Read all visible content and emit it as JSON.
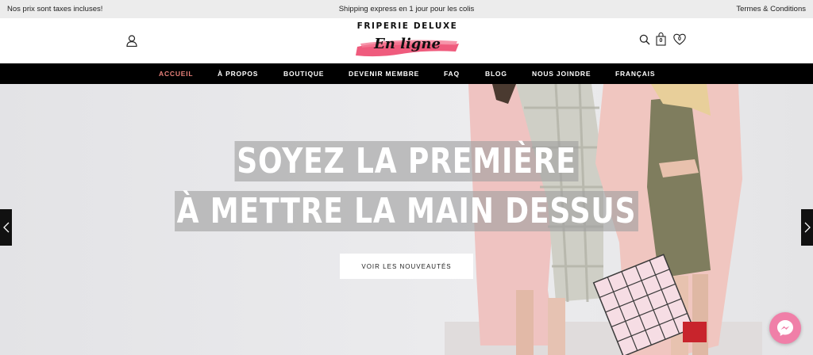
{
  "topbar": {
    "left_text": "Nos prix sont taxes incluses!",
    "center_text": "Shipping express en 1 jour pour les colis",
    "right_link": "Termes & Conditions"
  },
  "header": {
    "logo_brand": "FRIPERIE DELUXE",
    "logo_script": "En ligne",
    "cart_count": "0",
    "wishlist_count": "0",
    "icons": [
      "user-icon",
      "search-icon",
      "shopping-bag-icon",
      "heart-icon"
    ]
  },
  "nav": {
    "items": [
      {
        "label": "ACCUEIL",
        "active": true
      },
      {
        "label": "À PROPOS"
      },
      {
        "label": "BOUTIQUE"
      },
      {
        "label": "DEVENIR MEMBRE"
      },
      {
        "label": "FAQ"
      },
      {
        "label": "BLOG"
      },
      {
        "label": "NOUS JOINDRE"
      },
      {
        "label": "FRANÇAIS"
      }
    ]
  },
  "hero": {
    "headline_line1": "SOYEZ LA PREMIÈRE",
    "headline_line2": "À METTRE LA MAIN DESSUS",
    "cta_label": "VOIR LES NOUVEAUTÉS"
  },
  "colors": {
    "accent": "#e8817a",
    "nav_bg": "#000000",
    "topbar_bg": "#ececec",
    "logo_swash": "#ef5b7d",
    "messenger": "#f07fa8"
  }
}
